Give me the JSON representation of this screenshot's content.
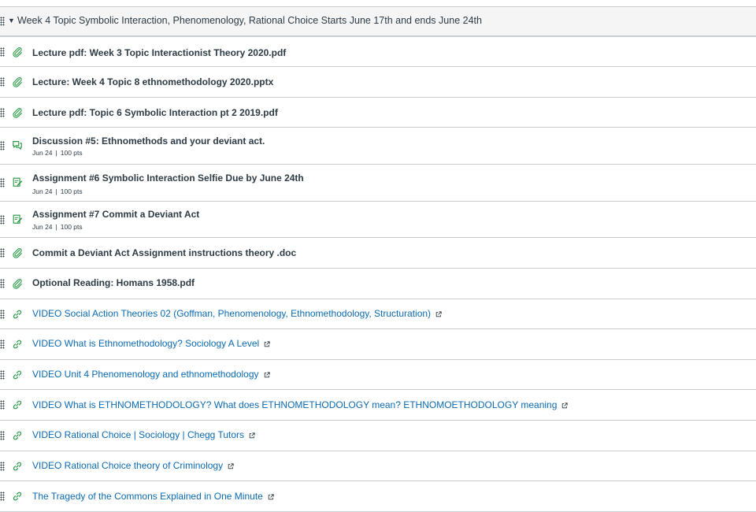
{
  "module": {
    "title": "Week 4 Topic Symbolic Interaction, Phenomenology, Rational Choice Starts June 17th and ends June 24th"
  },
  "items": [
    {
      "type": "attachment",
      "title": "Lecture pdf: Week 3 Topic Interactionist Theory 2020.pdf"
    },
    {
      "type": "attachment",
      "title": "Lecture: Week 4 Topic 8 ethnomethodology 2020.pptx"
    },
    {
      "type": "attachment",
      "title": "Lecture pdf: Topic 6 Symbolic Interaction pt 2 2019.pdf"
    },
    {
      "type": "discussion",
      "title": "Discussion #5: Ethnomethods and your deviant act.",
      "date": "Jun 24",
      "points": "100 pts"
    },
    {
      "type": "assignment",
      "title": "Assignment #6 Symbolic Interaction Selfie Due by June 24th",
      "date": "Jun 24",
      "points": "100 pts"
    },
    {
      "type": "assignment",
      "title": "Assignment #7 Commit a Deviant Act",
      "date": "Jun 24",
      "points": "100 pts"
    },
    {
      "type": "attachment",
      "title": "Commit a Deviant Act Assignment instructions theory .doc"
    },
    {
      "type": "attachment",
      "title": "Optional Reading: Homans 1958.pdf"
    },
    {
      "type": "link",
      "title": "VIDEO Social Action Theories 02 (Goffman, Phenomenology, Ethnomethodology, Structuration)"
    },
    {
      "type": "link",
      "title": "VIDEO What is Ethnomethodology? Sociology A Level"
    },
    {
      "type": "link",
      "title": "VIDEO Unit 4 Phenomenology and ethnomethodology"
    },
    {
      "type": "link",
      "title": "VIDEO What is ETHNOMETHODOLOGY? What does ETHNOMETHODOLOGY mean? ETHNOMOETHODOLOGY meaning"
    },
    {
      "type": "link",
      "title": "VIDEO Rational Choice | Sociology | Chegg Tutors"
    },
    {
      "type": "link",
      "title": "VIDEO Rational Choice theory of Criminology"
    },
    {
      "type": "link",
      "title": "The Tragedy of the Commons Explained in One Minute"
    }
  ],
  "colors": {
    "icon_green": "#2b9a47",
    "link_blue": "#0b6ab1",
    "text": "#2d3b45"
  }
}
